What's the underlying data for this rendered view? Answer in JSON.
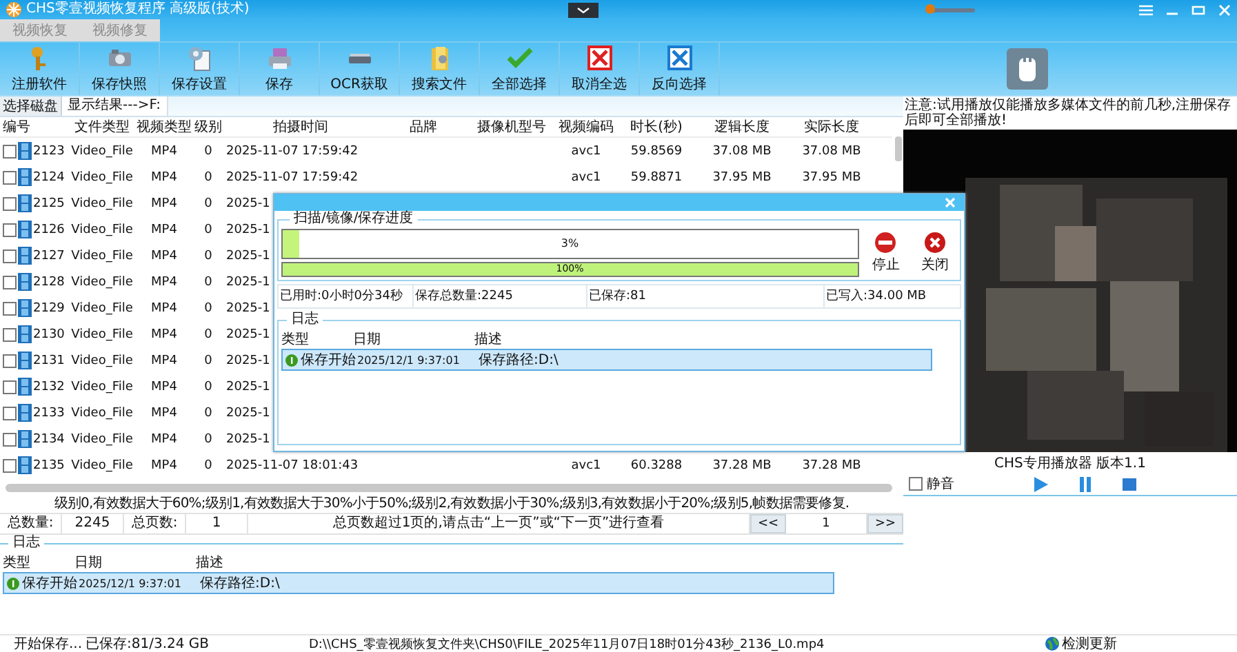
{
  "window": {
    "title": "CHS零壹视频恢复程序 高级版(技术)",
    "volume": {
      "level": 0.08
    }
  },
  "tabs": [
    {
      "label": "视频恢复",
      "disabled": true
    },
    {
      "label": "视频修复",
      "disabled": true
    }
  ],
  "toolbar": [
    {
      "label": "注册软件",
      "kind": "key"
    },
    {
      "label": "保存快照",
      "kind": "camera"
    },
    {
      "label": "保存设置",
      "kind": "settings"
    },
    {
      "label": "保存",
      "kind": "save"
    },
    {
      "label": "OCR获取",
      "kind": "scanner"
    },
    {
      "label": "搜索文件",
      "kind": "folder"
    },
    {
      "label": "全部选择",
      "kind": "check"
    },
    {
      "label": "取消全选",
      "kind": "cancel"
    },
    {
      "label": "反向选择",
      "kind": "invert"
    }
  ],
  "disk_bar": {
    "button": "选择磁盘",
    "result": "显示结果--->F:"
  },
  "table": {
    "columns": [
      "编号",
      "文件类型",
      "视频类型",
      "级别",
      "拍摄时间",
      "品牌",
      "摄像机型号",
      "视频编码",
      "时长(秒)",
      "逻辑长度",
      "实际长度"
    ],
    "rows": [
      {
        "id": "2123",
        "file_type": "Video_File",
        "video_type": "MP4",
        "level": "0",
        "time": "2025-11-07 17:59:42",
        "codec": "avc1",
        "duration": "59.8569",
        "logical": "37.08 MB",
        "actual": "37.08 MB",
        "checked": false
      },
      {
        "id": "2124",
        "file_type": "Video_File",
        "video_type": "MP4",
        "level": "0",
        "time": "2025-11-07 17:59:42",
        "codec": "avc1",
        "duration": "59.8871",
        "logical": "37.95 MB",
        "actual": "37.95 MB",
        "checked": false
      },
      {
        "id": "2125",
        "file_type": "Video_File",
        "video_type": "MP4",
        "level": "0",
        "time": "2025-1",
        "checked": false
      },
      {
        "id": "2126",
        "file_type": "Video_File",
        "video_type": "MP4",
        "level": "0",
        "time": "2025-1",
        "checked": false
      },
      {
        "id": "2127",
        "file_type": "Video_File",
        "video_type": "MP4",
        "level": "0",
        "time": "2025-1",
        "checked": false
      },
      {
        "id": "2128",
        "file_type": "Video_File",
        "video_type": "MP4",
        "level": "0",
        "time": "2025-1",
        "checked": false
      },
      {
        "id": "2129",
        "file_type": "Video_File",
        "video_type": "MP4",
        "level": "0",
        "time": "2025-1",
        "checked": false
      },
      {
        "id": "2130",
        "file_type": "Video_File",
        "video_type": "MP4",
        "level": "0",
        "time": "2025-1",
        "checked": false
      },
      {
        "id": "2131",
        "file_type": "Video_File",
        "video_type": "MP4",
        "level": "0",
        "time": "2025-1",
        "checked": false
      },
      {
        "id": "2132",
        "file_type": "Video_File",
        "video_type": "MP4",
        "level": "0",
        "time": "2025-1",
        "checked": false
      },
      {
        "id": "2133",
        "file_type": "Video_File",
        "video_type": "MP4",
        "level": "0",
        "time": "2025-1",
        "checked": false
      },
      {
        "id": "2134",
        "file_type": "Video_File",
        "video_type": "MP4",
        "level": "0",
        "time": "2025-1",
        "checked": false
      },
      {
        "id": "2135",
        "file_type": "Video_File",
        "video_type": "MP4",
        "level": "0",
        "time": "2025-11-07 18:01:43",
        "codec": "avc1",
        "duration": "60.3288",
        "logical": "37.28 MB",
        "actual": "37.28 MB",
        "checked": false
      }
    ]
  },
  "legend": "级别0,有效数据大于60%;级别1,有效数据大于30%小于50%;级别2,有效数据小于30%;级别3,有效数据小于20%;级别5,帧数据需要修复.",
  "pagination": {
    "total_label": "总数量:",
    "total": "2245",
    "pages_label": "总页数:",
    "pages": "1",
    "message": "总页数超过1页的,请点击“上一页”或“下一页”进行查看",
    "prev": "<<",
    "page": "1",
    "next": ">>"
  },
  "log": {
    "title": "日志",
    "columns": [
      "类型",
      "日期",
      "描述"
    ],
    "rows": [
      {
        "type": "保存开始",
        "date": "2025/12/1 9:37:01",
        "description": "保存路径:D:\\",
        "selected": true
      }
    ]
  },
  "status_bar": {
    "state": "开始保存...",
    "saved": "已保存:81/3.24 GB",
    "path": "D:\\\\CHS_零壹视频恢复文件夹\\CHS0\\FILE_2025年11月07日18时01分43秒_2136_L0.mp4",
    "update": "检测更新"
  },
  "player": {
    "note": "注意:试用播放仅能播放多媒体文件的前几秒,注册保存后即可全部播放!",
    "caption": "CHS专用播放器 版本1.1",
    "mute": {
      "label": "静音",
      "checked": false
    }
  },
  "dialog": {
    "progress_title": "扫描/镜像/保存进度",
    "bars": [
      {
        "label": "3%",
        "level": 0.03
      },
      {
        "label": "100%",
        "level": 1
      }
    ],
    "buttons": [
      {
        "label": "停止",
        "kind": "stop"
      },
      {
        "label": "关闭",
        "kind": "close"
      }
    ],
    "stats": [
      "已用时:0小时0分34秒",
      "保存总数量:2245",
      "已保存:81",
      "已写入:34.00 MB"
    ],
    "log": {
      "title": "日志",
      "columns": [
        "类型",
        "日期",
        "描述"
      ],
      "rows": [
        {
          "type": "保存开始",
          "date": "2025/12/1 9:37:01",
          "description": "保存路径:D:\\",
          "selected": true
        }
      ]
    }
  }
}
